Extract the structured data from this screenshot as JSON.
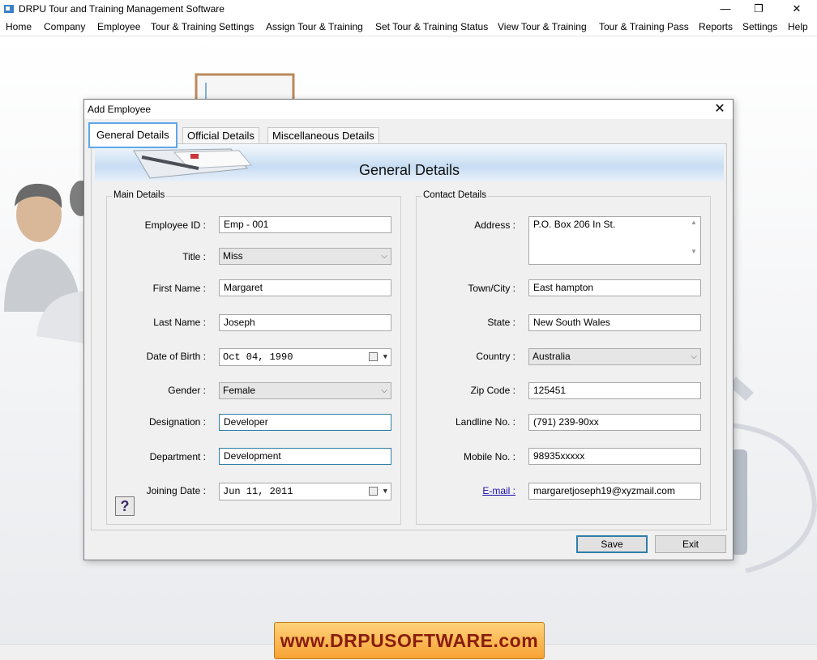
{
  "app": {
    "title": "DRPU Tour and Training Management Software"
  },
  "window_controls": {
    "minimize": "—",
    "restore": "❐",
    "close": "✕"
  },
  "menu": [
    "Home",
    "Company",
    "Employee",
    "Tour & Training Settings",
    "Assign Tour & Training",
    "Set Tour & Training Status",
    "View Tour & Training",
    "Tour & Training Pass",
    "Reports",
    "Settings",
    "Help"
  ],
  "dialog": {
    "title": "Add Employee",
    "close": "✕",
    "tabs": [
      "General Details",
      "Official Details",
      "Miscellaneous Details"
    ],
    "header": "General Details",
    "main_details": {
      "label": "Main Details",
      "employee_id_label": "Employee ID :",
      "employee_id": "Emp - 001",
      "title_label": "Title :",
      "title": "Miss",
      "first_name_label": "First Name :",
      "first_name": "Margaret",
      "last_name_label": "Last Name :",
      "last_name": "Joseph",
      "dob_label": "Date of Birth :",
      "dob": "Oct 04, 1990",
      "gender_label": "Gender :",
      "gender": "Female",
      "designation_label": "Designation :",
      "designation": "Developer",
      "department_label": "Department :",
      "department": "Development",
      "joining_date_label": "Joining Date :",
      "joining_date": "Jun 11, 2011",
      "help": "?"
    },
    "contact_details": {
      "label": "Contact Details",
      "address_label": "Address :",
      "address": "P.O. Box 206 In St.",
      "town_label": "Town/City :",
      "town": "East hampton",
      "state_label": "State :",
      "state": "New South Wales",
      "country_label": "Country :",
      "country": "Australia",
      "zip_label": "Zip Code :",
      "zip": "125451",
      "landline_label": "Landline No. :",
      "landline": "(791) 239-90xx",
      "mobile_label": "Mobile No. :",
      "mobile": "98935xxxxx",
      "email_label": "E-mail :",
      "email": "margaretjoseph19@xyzmail.com"
    },
    "buttons": {
      "save": "Save",
      "exit": "Exit"
    }
  },
  "banner": "www.DRPUSOFTWARE.com",
  "colors": {
    "accent": "#2f7ea8",
    "tab_focus": "#5fa7e8",
    "banner": "#f7a334",
    "banner_text": "#8a1c0c"
  }
}
